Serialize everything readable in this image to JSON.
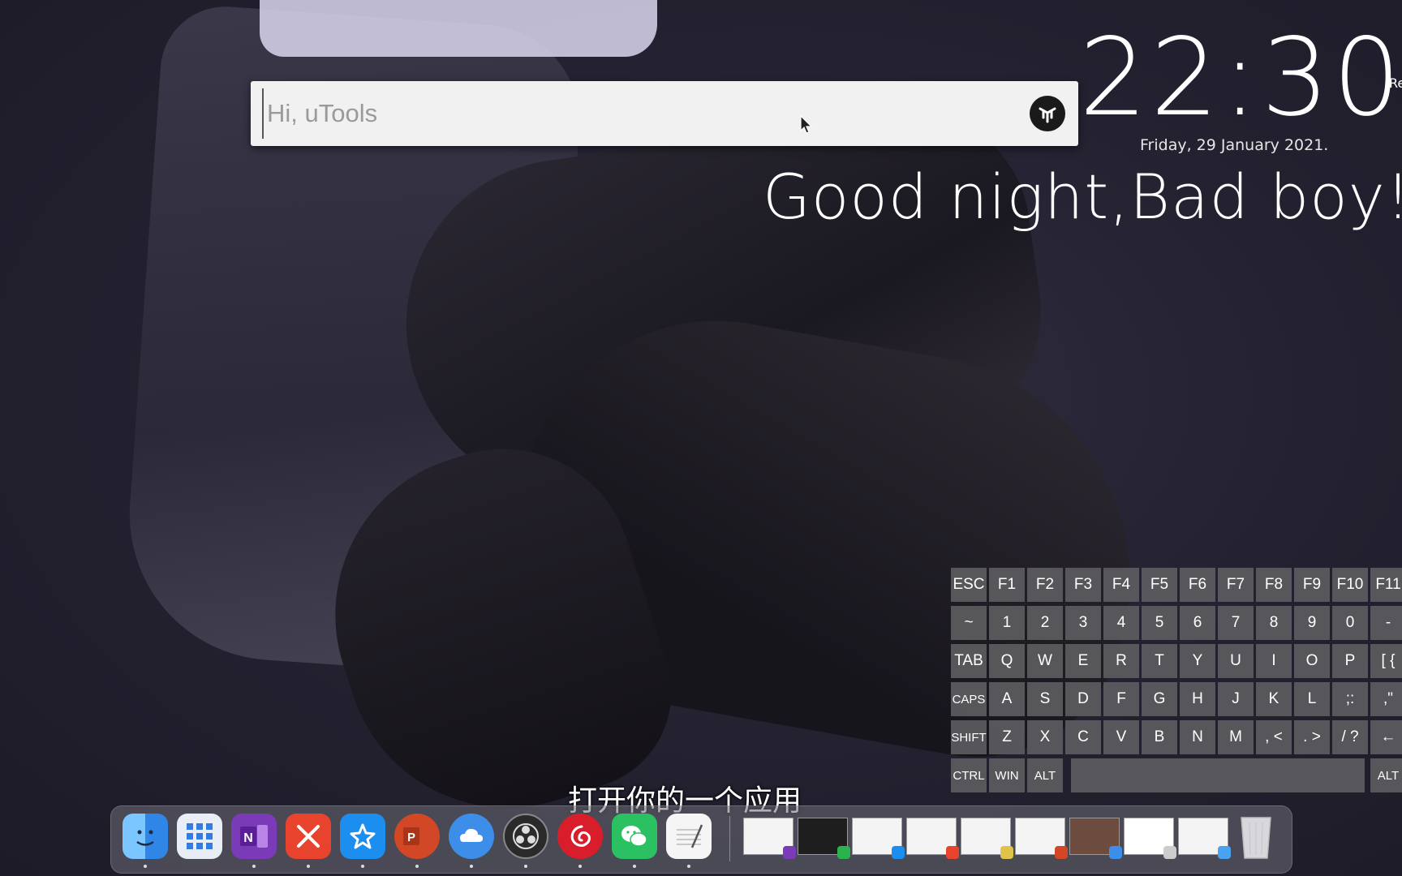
{
  "search": {
    "placeholder": "Hi, uTools"
  },
  "clock": {
    "time": "22:30",
    "side_text": "Re",
    "date": "Friday, 29 January 2021.",
    "greeting": "Good night,Bad boy!"
  },
  "keyboard": {
    "rows": [
      [
        "ESC",
        "F1",
        "F2",
        "F3",
        "F4",
        "F5",
        "F6",
        "F7",
        "F8",
        "F9",
        "F10",
        "F11"
      ],
      [
        "~",
        "1",
        "2",
        "3",
        "4",
        "5",
        "6",
        "7",
        "8",
        "9",
        "0",
        "-"
      ],
      [
        "TAB",
        "Q",
        "W",
        "E",
        "R",
        "T",
        "Y",
        "U",
        "I",
        "O",
        "P",
        "[ {"
      ],
      [
        "CAPS",
        "A",
        "S",
        "D",
        "F",
        "G",
        "H",
        "J",
        "K",
        "L",
        ";:",
        ",\""
      ],
      [
        "SHIFT",
        "Z",
        "X",
        "C",
        "V",
        "B",
        "N",
        "M",
        ", <",
        ". >",
        "/ ?",
        "←"
      ],
      [
        "CTRL",
        "WIN",
        "ALT",
        "",
        "ALT"
      ]
    ]
  },
  "subtitle": "打开你的一个应用",
  "dock": {
    "apps": [
      {
        "name": "finder",
        "color": "#4aa3f0"
      },
      {
        "name": "launchpad",
        "color": "#e9edf5"
      },
      {
        "name": "onenote",
        "color": "#7b3bb8"
      },
      {
        "name": "xmind",
        "color": "#e8432c"
      },
      {
        "name": "app-star",
        "color": "#1b8ef0"
      },
      {
        "name": "powerpoint",
        "color": "#d24726"
      },
      {
        "name": "cloud-app",
        "color": "#3d8ee8"
      },
      {
        "name": "obs",
        "color": "#2a2a2a"
      },
      {
        "name": "netease-music",
        "color": "#d81e2a"
      },
      {
        "name": "wechat",
        "color": "#2bc163"
      },
      {
        "name": "notes",
        "color": "#f5f5f5"
      }
    ],
    "windows": [
      {
        "name": "window-onenote",
        "badge": "#7b3bb8"
      },
      {
        "name": "window-terminal",
        "badge": "#2bb24c"
      },
      {
        "name": "window-app-star",
        "badge": "#1b8ef0"
      },
      {
        "name": "window-xmind",
        "badge": "#e8432c"
      },
      {
        "name": "window-notes",
        "badge": "#e0c34a"
      },
      {
        "name": "window-powerpoint",
        "badge": "#d24726"
      },
      {
        "name": "window-photo",
        "badge": "#3d8ee8"
      },
      {
        "name": "window-blank",
        "badge": "#cccccc"
      },
      {
        "name": "window-finder",
        "badge": "#4aa3f0"
      }
    ],
    "trash": "trash"
  },
  "colors": {
    "accent_bg": "#23212f",
    "key_bg": "#5c5c60",
    "search_bg": "#f1f1f1"
  }
}
